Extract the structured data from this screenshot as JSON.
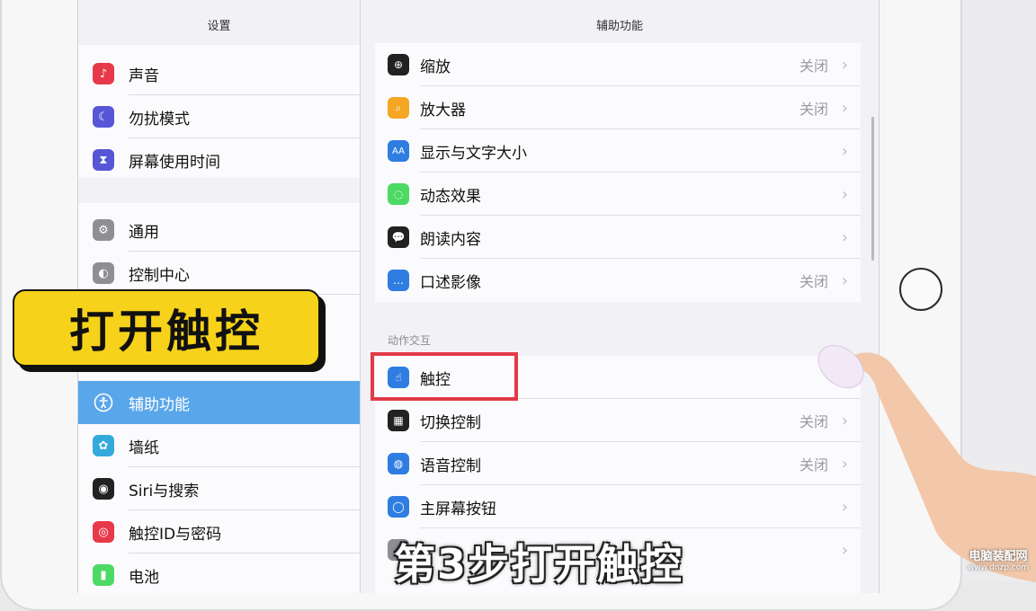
{
  "sidebar": {
    "title": "设置",
    "items": [
      {
        "label": "声音",
        "icon": "speaker-icon",
        "color": "#e8394a"
      },
      {
        "label": "勿扰模式",
        "icon": "moon-icon",
        "color": "#5856d6"
      },
      {
        "label": "屏幕使用时间",
        "icon": "hourglass-icon",
        "color": "#5856d6"
      },
      {
        "label": "通用",
        "icon": "gear-icon",
        "color": "#8e8e93"
      },
      {
        "label": "控制中心",
        "icon": "toggles-icon",
        "color": "#8e8e93"
      },
      {
        "label": "辅助功能",
        "icon": "accessibility-icon",
        "color": "#2f7de1"
      },
      {
        "label": "墙纸",
        "icon": "flower-icon",
        "color": "#34aadc"
      },
      {
        "label": "Siri与搜索",
        "icon": "siri-icon",
        "color": "#222222"
      },
      {
        "label": "触控ID与密码",
        "icon": "fingerprint-icon",
        "color": "#e8394a"
      },
      {
        "label": "电池",
        "icon": "battery-icon",
        "color": "#4cd964"
      }
    ]
  },
  "detail": {
    "title": "辅助功能",
    "section_header": "动作交互",
    "rows": [
      {
        "label": "缩放",
        "value": "关闭",
        "icon": "zoom-icon",
        "color": "#222222"
      },
      {
        "label": "放大器",
        "value": "关闭",
        "icon": "magnifier-icon",
        "color": "#f5a623"
      },
      {
        "label": "显示与文字大小",
        "value": "",
        "icon": "text-size-icon",
        "color": "#2f7de1"
      },
      {
        "label": "动态效果",
        "value": "",
        "icon": "motion-icon",
        "color": "#4cd964"
      },
      {
        "label": "朗读内容",
        "value": "",
        "icon": "speech-bubble-icon",
        "color": "#222222"
      },
      {
        "label": "口述影像",
        "value": "关闭",
        "icon": "audio-description-icon",
        "color": "#2f7de1"
      },
      {
        "label": "触控",
        "value": "",
        "icon": "touch-hand-icon",
        "color": "#2f7de1"
      },
      {
        "label": "切换控制",
        "value": "关闭",
        "icon": "switch-control-icon",
        "color": "#222222"
      },
      {
        "label": "语音控制",
        "value": "关闭",
        "icon": "voice-control-icon",
        "color": "#2f7de1"
      },
      {
        "label": "主屏幕按钮",
        "value": "",
        "icon": "home-button-icon",
        "color": "#2f7de1"
      }
    ]
  },
  "overlay": {
    "caption": "打开触控",
    "subtitle": "第3步打开触控",
    "watermark_top": "电脑装配网",
    "watermark_bottom": "www.dnzp.com"
  }
}
